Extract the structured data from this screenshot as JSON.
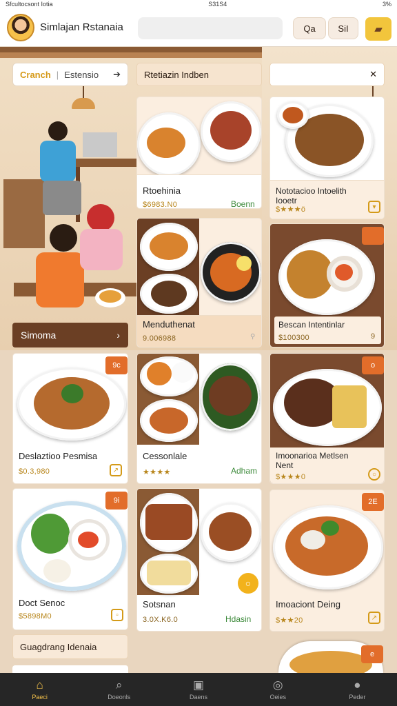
{
  "status": {
    "left": "Sfcultocsont Iotia",
    "center": "S31S4",
    "right": "3%"
  },
  "header": {
    "title": "Simlajan Rstanaia",
    "search_placeholder": "",
    "btn_q": "Qa",
    "btn_s": "SiI",
    "cart_icon": "cart-icon"
  },
  "filter": {
    "active": "Cranch",
    "other": "Estensio",
    "arrow": "➔"
  },
  "scene": {
    "section_label": "Simoma",
    "section_arrow": "›"
  },
  "chips": {
    "mid": "Rtetiazin Indben",
    "right_icon": "✕"
  },
  "cards": [
    {
      "name": "Rtoehinia",
      "price": "$6983.N0",
      "tag": "Boenn"
    },
    {
      "name": "Nototacioo Intoelith Iooetr",
      "price": "$★★★ö",
      "badge": ""
    },
    {
      "name": "Menduthenat",
      "price": "9.006988"
    },
    {
      "name": "Bescan Intentinlar",
      "price": "$100300",
      "badge": "",
      "extra": "9"
    },
    {
      "name": "Deslaztioo Pesmisa",
      "price": "$0.3,980",
      "badge": "9c"
    },
    {
      "name": "Cessonlale",
      "price": "★★★★",
      "tag": "Adham"
    },
    {
      "name": "Imoonarioa Metlsen Nent",
      "price": "$★★★0",
      "badge": "o"
    },
    {
      "name": "Doct Senoc",
      "price": "$5898M0",
      "badge": "9i"
    },
    {
      "name": "Sotsnan",
      "price": "3.0X.K6.0",
      "tag": "Hdasin"
    },
    {
      "name": "Imoaciont Deing",
      "price": "$★★20",
      "badge": "2E"
    }
  ],
  "bottom_section": {
    "label": "Guagdrang Idenaia",
    "badge": "e"
  },
  "nav": [
    {
      "label": "Paeci",
      "icon": "home-icon"
    },
    {
      "label": "Doeonls",
      "icon": "search-icon"
    },
    {
      "label": "Daens",
      "icon": "camera-icon"
    },
    {
      "label": "Oeies",
      "icon": "globe-icon"
    },
    {
      "label": "Peder",
      "icon": "profile-icon"
    }
  ],
  "colors": {
    "accent": "#f2c53c",
    "price": "#b8861c",
    "badge": "#e26d2a",
    "brown": "#6b3f24"
  }
}
